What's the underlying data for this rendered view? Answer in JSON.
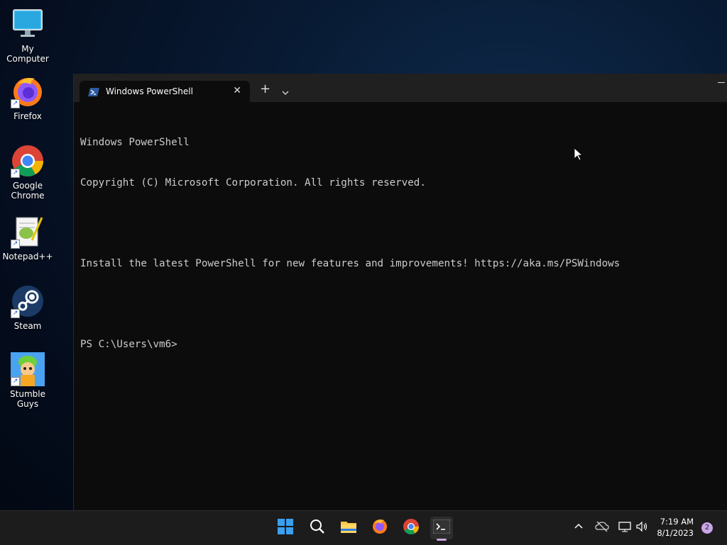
{
  "desktop": {
    "icons": [
      {
        "label": "My Computer",
        "icon": "monitor-icon"
      },
      {
        "label": "Firefox",
        "icon": "firefox-icon"
      },
      {
        "label": "Google Chrome",
        "icon": "chrome-icon"
      },
      {
        "label": "Notepad++",
        "icon": "notepadpp-icon"
      },
      {
        "label": "Steam",
        "icon": "steam-icon"
      },
      {
        "label": "Stumble Guys",
        "icon": "stumble-guys-icon"
      }
    ]
  },
  "terminal": {
    "tab_title": "Windows PowerShell",
    "lines": [
      "Windows PowerShell",
      "Copyright (C) Microsoft Corporation. All rights reserved.",
      "",
      "Install the latest PowerShell for new features and improvements! https://aka.ms/PSWindows",
      "",
      "PS C:\\Users\\vm6>"
    ]
  },
  "taskbar": {
    "apps": [
      "start-icon",
      "search-icon",
      "file-explorer-icon",
      "firefox-icon",
      "chrome-icon",
      "terminal-icon"
    ],
    "active_app": "terminal-icon",
    "clock": {
      "time": "7:19 AM",
      "date": "8/1/2023"
    },
    "notifications": "2"
  },
  "colors": {
    "console_bg": "#0c0c0c",
    "console_text": "#cccccc",
    "titlebar": "#202020",
    "taskbar": "#1c1c1c",
    "accent": "#c9a6e8"
  }
}
